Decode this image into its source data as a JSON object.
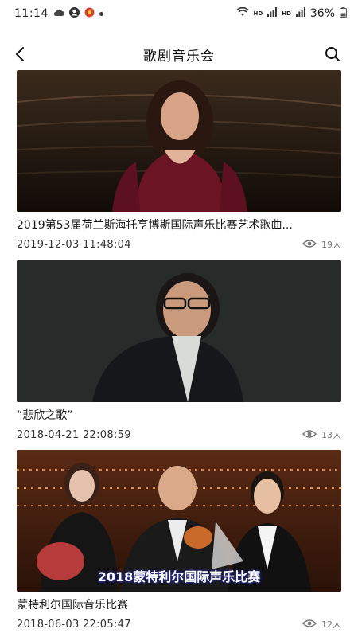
{
  "status": {
    "time": "11:14",
    "battery": "36%"
  },
  "header": {
    "title": "歌剧音乐会"
  },
  "videos": [
    {
      "title": "2019第53届荷兰斯海托亨博斯国际声乐比赛艺术歌曲...",
      "date": "2019-12-03 11:48:04",
      "views": "19人"
    },
    {
      "title": "“悲欣之歌”",
      "date": "2018-04-21 22:08:59",
      "views": "13人"
    },
    {
      "title": "蒙特利尔国际音乐比赛",
      "date": "2018-06-03 22:05:47",
      "views": "12人",
      "caption": "2018蒙特利尔国际声乐比赛"
    }
  ]
}
